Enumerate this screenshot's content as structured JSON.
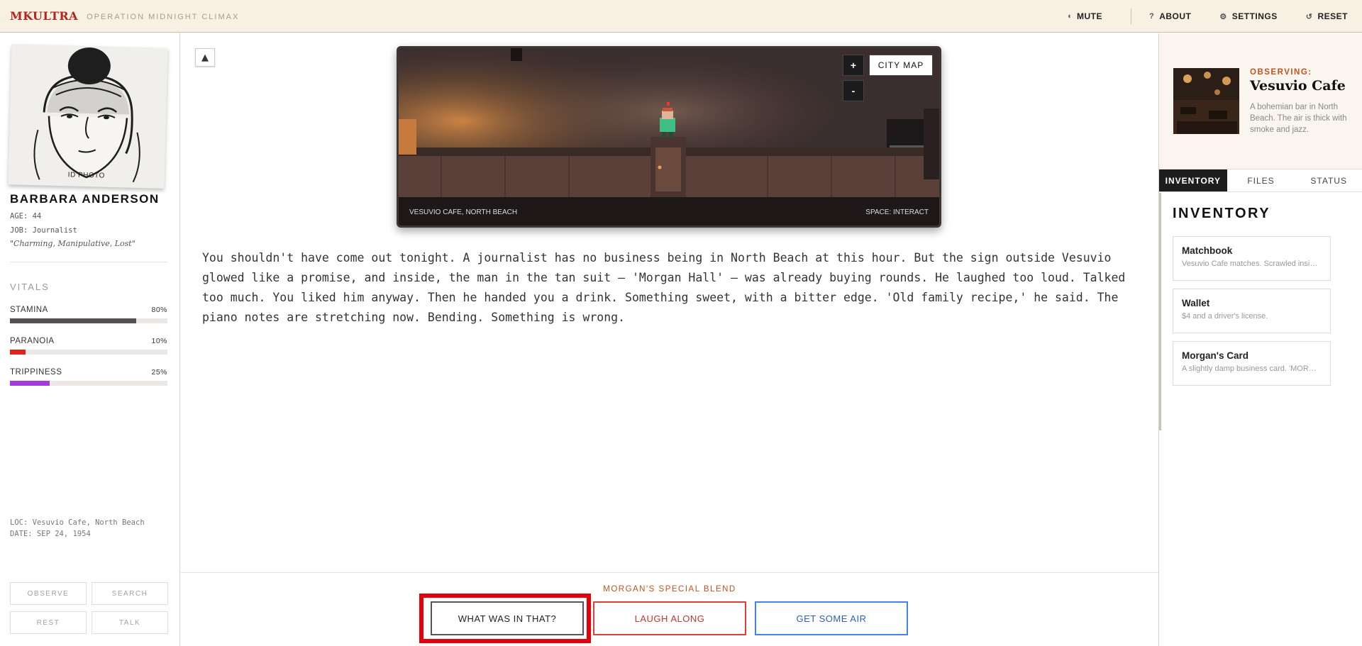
{
  "header": {
    "logo": "MKULTRA",
    "subtitle": "OPERATION MIDNIGHT CLIMAX",
    "buttons": [
      {
        "icon": "speaker-icon",
        "glyph": "◖",
        "label": "MUTE"
      },
      {
        "icon": "question-icon",
        "glyph": "?",
        "label": "ABOUT"
      },
      {
        "icon": "gear-icon",
        "glyph": "⚙",
        "label": "SETTINGS"
      },
      {
        "icon": "reset-icon",
        "glyph": "↺",
        "label": "RESET"
      }
    ]
  },
  "character": {
    "photo_label": "ID PHOTO",
    "name": "BARBARA ANDERSON",
    "age": "AGE: 44",
    "job": "JOB: Journalist",
    "traits": "\"Charming, Manipulative, Lost\""
  },
  "vitals": {
    "title": "VITALS",
    "items": [
      {
        "label": "STAMINA",
        "value": "80%",
        "fraction": 0.8,
        "color": "#555152"
      },
      {
        "label": "PARANOIA",
        "value": "10%",
        "fraction": 0.1,
        "color": "#e0231d"
      },
      {
        "label": "TRIPPINESS",
        "value": "25%",
        "fraction": 0.25,
        "color": "#a43be0"
      }
    ]
  },
  "location": {
    "loc": "LOC: Vesuvio Cafe, North Beach",
    "date": "DATE: SEP 24, 1954"
  },
  "actions": [
    "OBSERVE",
    "SEARCH",
    "REST",
    "TALK"
  ],
  "scene": {
    "collapse_glyph": "▲",
    "zoom_in": "+",
    "zoom_out": "-",
    "city_map": "CITY MAP",
    "location_label": "VESUVIO CAFE, NORTH BEACH",
    "hint": "SPACE: INTERACT"
  },
  "narrative": "You shouldn't have come out tonight. A journalist has no business being in North Beach at this hour. But the sign outside Vesuvio glowed like a promise, and inside, the man in the tan suit — 'Morgan Hall' — was already buying rounds. He laughed too loud. Talked too much. You liked him anyway. Then he handed you a drink. Something sweet, with a bitter edge. 'Old family recipe,' he said. The piano notes are stretching now. Bending. Something is wrong.",
  "choices": {
    "title": "MORGAN'S SPECIAL BLEND",
    "options": [
      {
        "label": "WHAT WAS IN THAT?",
        "color": "#555555"
      },
      {
        "label": "LAUGH ALONG",
        "color": "#d9413a"
      },
      {
        "label": "GET SOME AIR",
        "color": "#3f86e8"
      }
    ]
  },
  "observing": {
    "kicker": "OBSERVING:",
    "title": "Vesuvio Cafe",
    "description": "A bohemian bar in North Beach. The air is thick with smoke and jazz."
  },
  "tabs": [
    "INVENTORY",
    "FILES",
    "STATUS"
  ],
  "inventory": {
    "title": "INVENTORY",
    "items": [
      {
        "name": "Matchbook",
        "description": "Vesuvio Cafe matches. Scrawled inside the cover..."
      },
      {
        "name": "Wallet",
        "description": "$4 and a driver's license."
      },
      {
        "name": "Morgan's Card",
        "description": "A slightly damp business card. 'MORGAN HALL...'"
      }
    ]
  }
}
